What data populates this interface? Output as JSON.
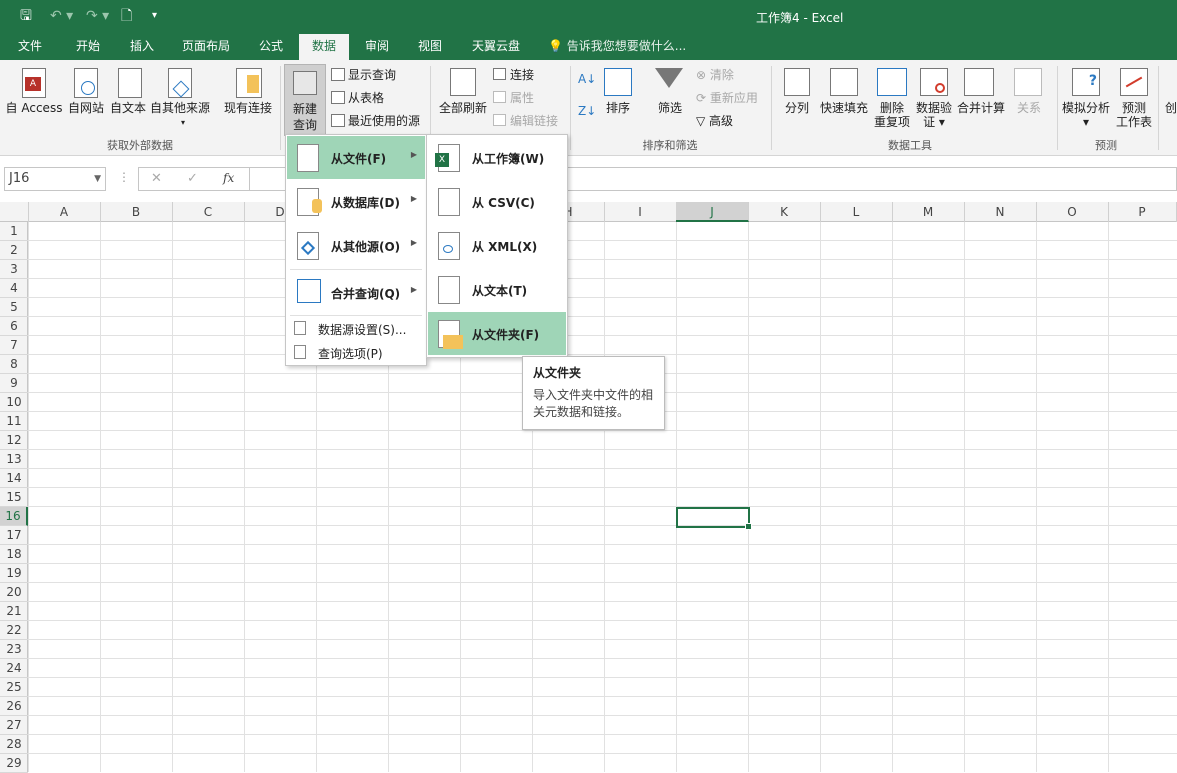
{
  "window": {
    "title": "工作簿4 - Excel"
  },
  "quick_access": {
    "save": "save-icon",
    "undo": "undo-icon",
    "redo": "redo-icon",
    "new": "new-icon",
    "customize": "customize-icon"
  },
  "tabs": [
    "文件",
    "开始",
    "插入",
    "页面布局",
    "公式",
    "数据",
    "审阅",
    "视图",
    "天翼云盘"
  ],
  "active_tab": "数据",
  "tell_me": "告诉我您想要做什么...",
  "ribbon": {
    "get_external": {
      "buttons": [
        "自 Access",
        "自网站",
        "自文本",
        "自其他来源",
        "现有连接"
      ],
      "group": "获取外部数据"
    },
    "new_query": {
      "line1": "新建",
      "line2": "查询",
      "items": [
        "显示查询",
        "从表格",
        "最近使用的源"
      ]
    },
    "connections": {
      "refresh": "全部刷新",
      "items": [
        "连接",
        "属性",
        "编辑链接"
      ]
    },
    "sort_filter": {
      "sort": "排序",
      "filter": "筛选",
      "items": [
        "清除",
        "重新应用",
        "高级"
      ],
      "group": "排序和筛选"
    },
    "data_tools": {
      "buttons": [
        "分列",
        "快速填充"
      ],
      "remove_dup": [
        "删除",
        "重复项"
      ],
      "validate": [
        "数据验",
        "证"
      ],
      "consolidate": "合并计算",
      "relations": "关系",
      "group": "数据工具"
    },
    "forecast": {
      "what_if": "模拟分析",
      "sheet": [
        "预测",
        "工作表"
      ],
      "group": "预测"
    },
    "more": "创"
  },
  "formula_bar": {
    "name_box": "J16",
    "cancel": "✕",
    "enter": "✓",
    "fx": "fx",
    "value": ""
  },
  "columns": [
    "A",
    "B",
    "C",
    "D",
    "E",
    "F",
    "G",
    "H",
    "I",
    "J",
    "K",
    "L",
    "M",
    "N",
    "O",
    "P"
  ],
  "rows": [
    "1",
    "2",
    "3",
    "4",
    "5",
    "6",
    "7",
    "8",
    "9",
    "10",
    "11",
    "12",
    "13",
    "14",
    "15",
    "16",
    "17",
    "18",
    "19",
    "20",
    "21",
    "22",
    "23",
    "24",
    "25",
    "26",
    "27",
    "28",
    "29"
  ],
  "selected": {
    "column": "J",
    "row": "16"
  },
  "menu1": {
    "items": [
      {
        "label": "从文件(F)",
        "icon": "file-icon"
      },
      {
        "label": "从数据库(D)",
        "icon": "database-icon"
      },
      {
        "label": "从其他源(O)",
        "icon": "other-source-icon"
      },
      {
        "label": "合并查询(Q)",
        "icon": "combine-icon"
      }
    ],
    "small": [
      "数据源设置(S)...",
      "查询选项(P)"
    ]
  },
  "menu2": {
    "items": [
      {
        "label": "从工作簿(W)",
        "icon": "excel-icon"
      },
      {
        "label": "从 CSV(C)",
        "icon": "csv-icon"
      },
      {
        "label": "从 XML(X)",
        "icon": "xml-icon"
      },
      {
        "label": "从文本(T)",
        "icon": "text-file-icon"
      },
      {
        "label": "从文件夹(F)",
        "icon": "folder-icon"
      }
    ]
  },
  "tooltip": {
    "title": "从文件夹",
    "body": "导入文件夹中文件的相关元数据和链接。"
  },
  "colors": {
    "accent": "#217346",
    "highlight": "#9fd5b7"
  }
}
